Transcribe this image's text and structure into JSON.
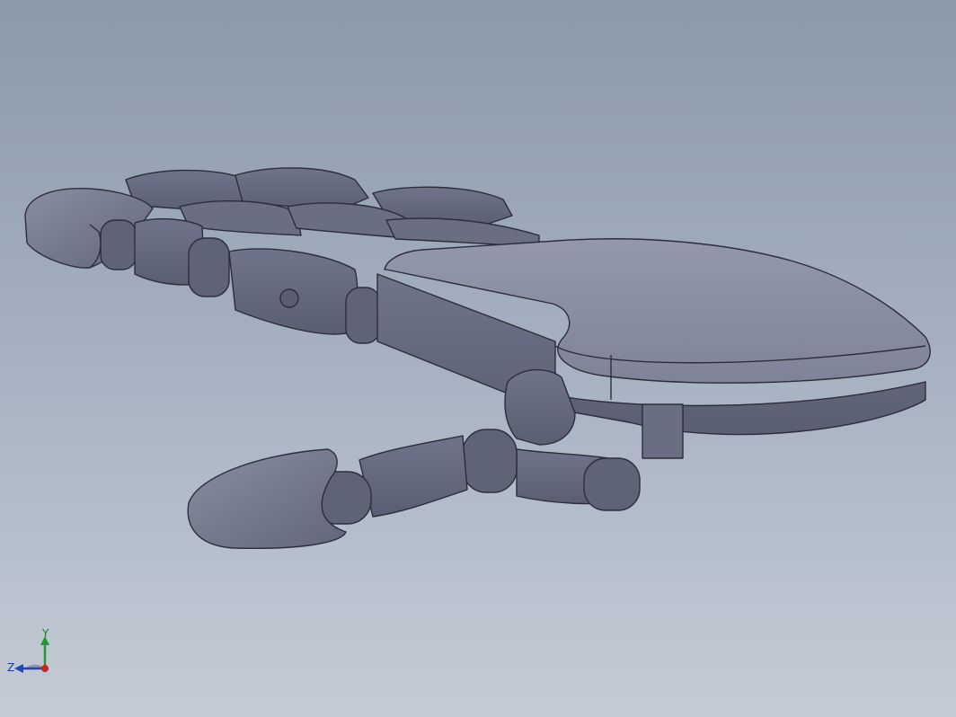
{
  "viewport": {
    "background_top": "#8c99a9",
    "background_bottom": "#c4cbd6",
    "model_color": "#6d7184",
    "model_highlight": "#8f93a6",
    "edge_color": "#2b2e3a"
  },
  "triad": {
    "x_axis_color": "#cc2222",
    "y_axis_color": "#229933",
    "z_axis_color": "#2244bb",
    "y_label": "Y",
    "z_label": "Z"
  }
}
